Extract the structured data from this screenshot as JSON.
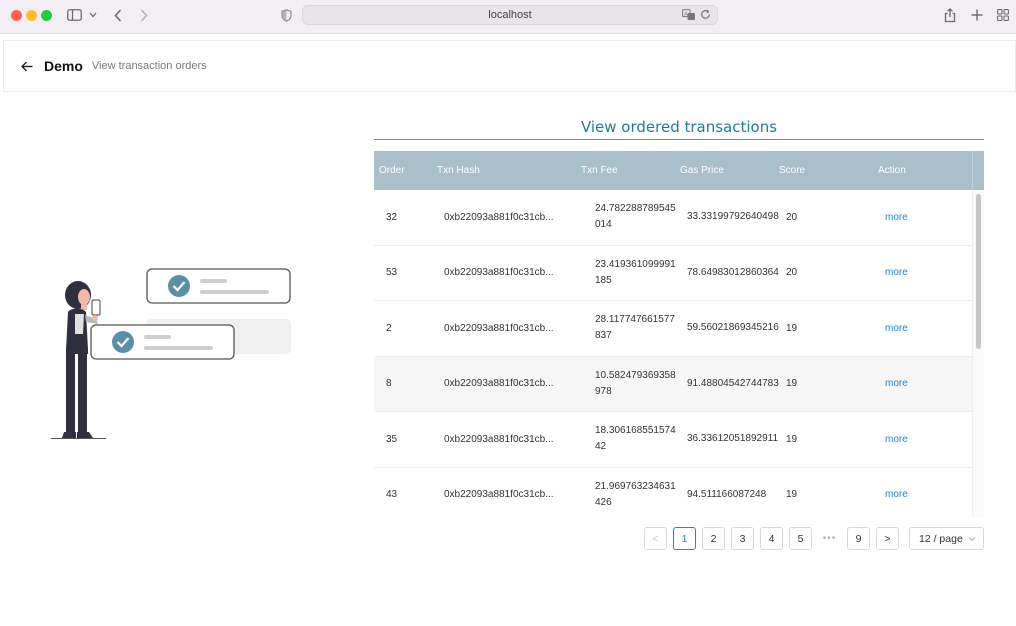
{
  "browser": {
    "url": "localhost"
  },
  "header": {
    "title": "Demo",
    "subtitle": "View transaction orders"
  },
  "section": {
    "title": "View ordered transactions"
  },
  "table": {
    "columns": [
      "Order",
      "Txn Hash",
      "Txn Fee",
      "Gas Price",
      "Score",
      "Action"
    ],
    "rows": [
      {
        "order": "32",
        "hash": "0xb22093a881f0c31cb...",
        "fee": "24.782288789545014",
        "gas": "33.33199792640498",
        "score": "20",
        "action": "more"
      },
      {
        "order": "53",
        "hash": "0xb22093a881f0c31cb...",
        "fee": "23.419361099991185",
        "gas": "78.64983012860364",
        "score": "20",
        "action": "more"
      },
      {
        "order": "2",
        "hash": "0xb22093a881f0c31cb...",
        "fee": "28.117747661577837",
        "gas": "59.56021869345216",
        "score": "19",
        "action": "more"
      },
      {
        "order": "8",
        "hash": "0xb22093a881f0c31cb...",
        "fee": "10.582479369358978",
        "gas": "91.48804542744783",
        "score": "19",
        "action": "more"
      },
      {
        "order": "35",
        "hash": "0xb22093a881f0c31cb...",
        "fee": "18.30616855157442",
        "gas": "36.33612051892911",
        "score": "19",
        "action": "more"
      },
      {
        "order": "43",
        "hash": "0xb22093a881f0c31cb...",
        "fee": "21.969763234631426",
        "gas": "94.511166087248",
        "score": "19",
        "action": "more"
      }
    ]
  },
  "pagination": {
    "prev": "<",
    "pages": [
      "1",
      "2",
      "3",
      "4",
      "5"
    ],
    "ellipsis": "•••",
    "last": "9",
    "next": ">",
    "current": "1",
    "page_size": "12 / page"
  },
  "colors": {
    "accent": "#1e88d8",
    "title": "#1f7aa3",
    "table_header": "#a9bfcc",
    "illustration_check": "#5b8fa8"
  },
  "icons": [
    "sidebar-icon",
    "chevron-left-icon",
    "chevron-right-icon",
    "shield-icon",
    "translate-icon",
    "reload-icon",
    "share-icon",
    "plus-icon",
    "tabs-grid-icon",
    "arrow-left-icon",
    "check-circle-icon",
    "chevron-down-icon"
  ]
}
